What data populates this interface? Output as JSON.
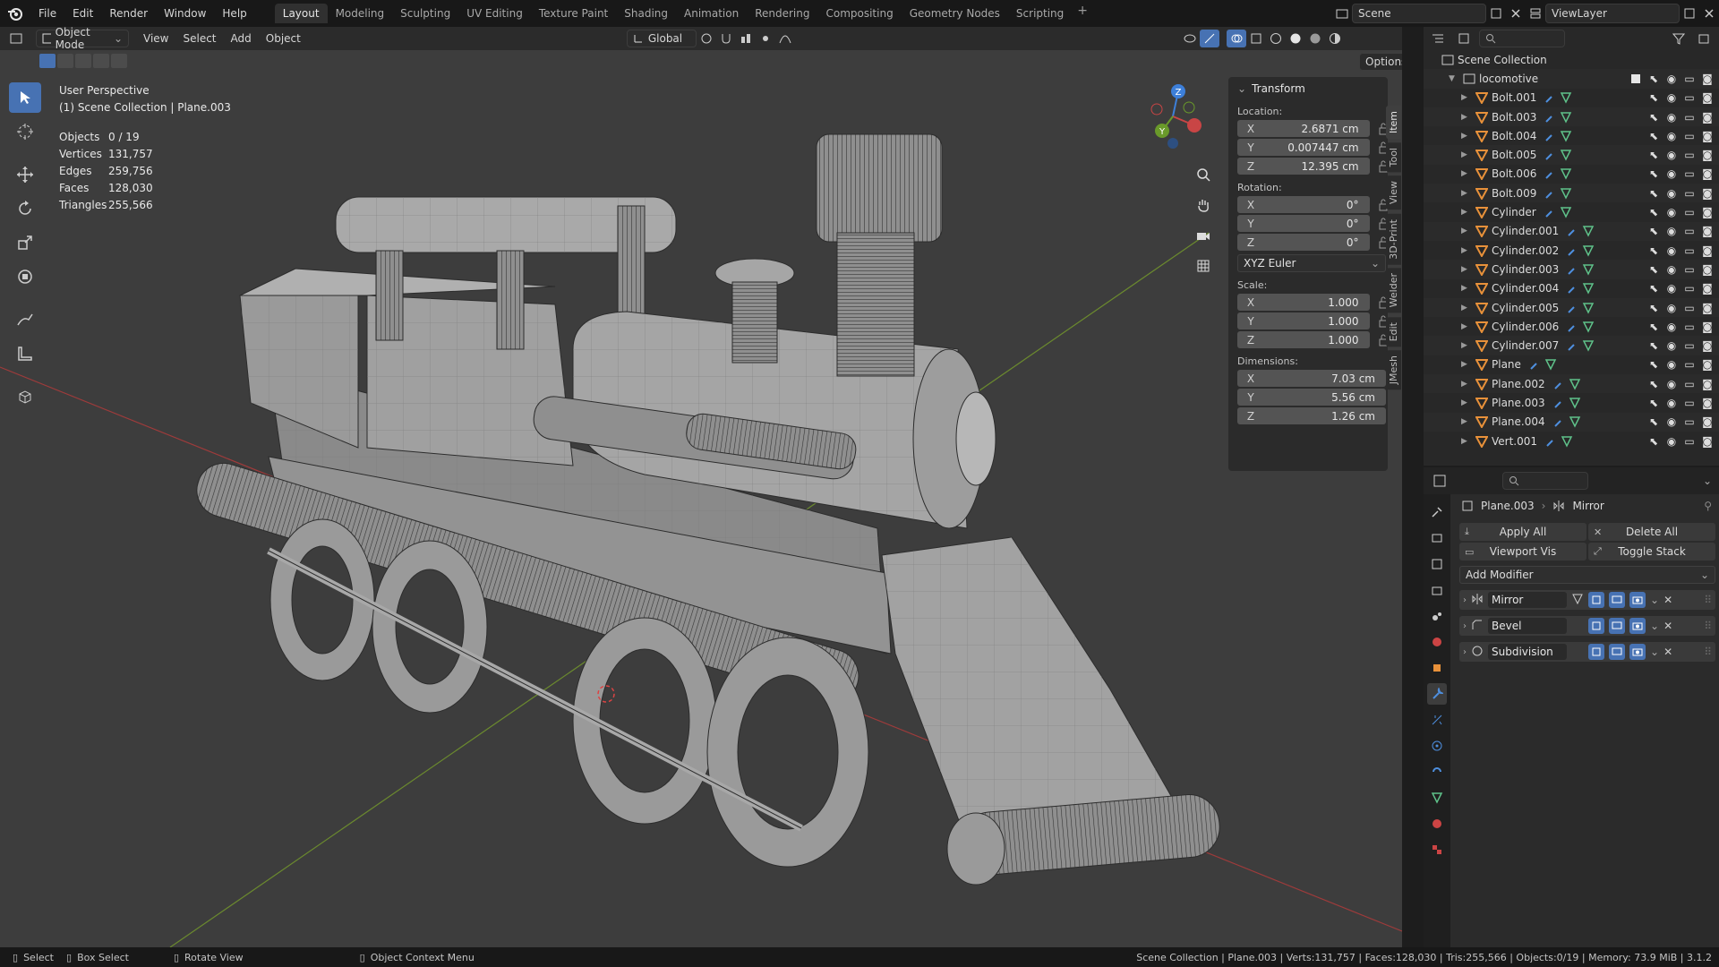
{
  "menu": {
    "items": [
      "File",
      "Edit",
      "Render",
      "Window",
      "Help"
    ],
    "workspaces": [
      "Layout",
      "Modeling",
      "Sculpting",
      "UV Editing",
      "Texture Paint",
      "Shading",
      "Animation",
      "Rendering",
      "Compositing",
      "Geometry Nodes",
      "Scripting"
    ],
    "active_workspace": "Layout",
    "scene": "Scene",
    "view_layer": "ViewLayer"
  },
  "viewport": {
    "mode": "Object Mode",
    "menus": [
      "View",
      "Select",
      "Add",
      "Object"
    ],
    "orientation": "Global",
    "options_label": "Options",
    "perspective": "User Perspective",
    "context": "(1) Scene Collection | Plane.003",
    "stats": [
      {
        "label": "Objects",
        "value": "0 / 19"
      },
      {
        "label": "Vertices",
        "value": "131,757"
      },
      {
        "label": "Edges",
        "value": "259,756"
      },
      {
        "label": "Faces",
        "value": "128,030"
      },
      {
        "label": "Triangles",
        "value": "255,566"
      }
    ]
  },
  "npanel": {
    "title": "Transform",
    "location_label": "Location:",
    "location": {
      "x": "2.6871 cm",
      "y": "0.007447 cm",
      "z": "12.395 cm"
    },
    "rotation_label": "Rotation:",
    "rotation": {
      "x": "0°",
      "y": "0°",
      "z": "0°"
    },
    "rotation_mode": "XYZ Euler",
    "scale_label": "Scale:",
    "scale": {
      "x": "1.000",
      "y": "1.000",
      "z": "1.000"
    },
    "dimensions_label": "Dimensions:",
    "dimensions": {
      "x": "7.03 cm",
      "y": "5.56 cm",
      "z": "1.26 cm"
    },
    "axis": {
      "x": "X",
      "y": "Y",
      "z": "Z"
    },
    "tabs": [
      "Item",
      "Tool",
      "View",
      "3D-Print",
      "Welder",
      "Edit",
      "JMesh"
    ]
  },
  "outliner": {
    "root": "Scene Collection",
    "collection": "locomotive",
    "objects": [
      "Bolt.001",
      "Bolt.003",
      "Bolt.004",
      "Bolt.005",
      "Bolt.006",
      "Bolt.009",
      "Cylinder",
      "Cylinder.001",
      "Cylinder.002",
      "Cylinder.003",
      "Cylinder.004",
      "Cylinder.005",
      "Cylinder.006",
      "Cylinder.007",
      "Plane",
      "Plane.002",
      "Plane.003",
      "Plane.004",
      "Vert.001"
    ]
  },
  "properties": {
    "object": "Plane.003",
    "section": "Mirror",
    "apply_all": "Apply All",
    "delete_all": "Delete All",
    "viewport_vis": "Viewport Vis",
    "toggle_stack": "Toggle Stack",
    "add_modifier": "Add Modifier",
    "modifiers": [
      "Mirror",
      "Bevel",
      "Subdivision"
    ]
  },
  "status": {
    "select": "Select",
    "box_select": "Box Select",
    "rotate_view": "Rotate View",
    "context_menu": "Object Context Menu",
    "info": "Scene Collection | Plane.003 | Verts:131,757 | Faces:128,030 | Tris:255,566 | Objects:0/19 | Memory: 73.9 MiB | 3.1.2"
  },
  "colors": {
    "accent": "#4772b3",
    "object_orange": "#e8913a",
    "mesh_green": "#5fc28a",
    "x_axis": "#c94545",
    "y_axis": "#6a9a2a",
    "z_axis": "#3d7fd9"
  }
}
